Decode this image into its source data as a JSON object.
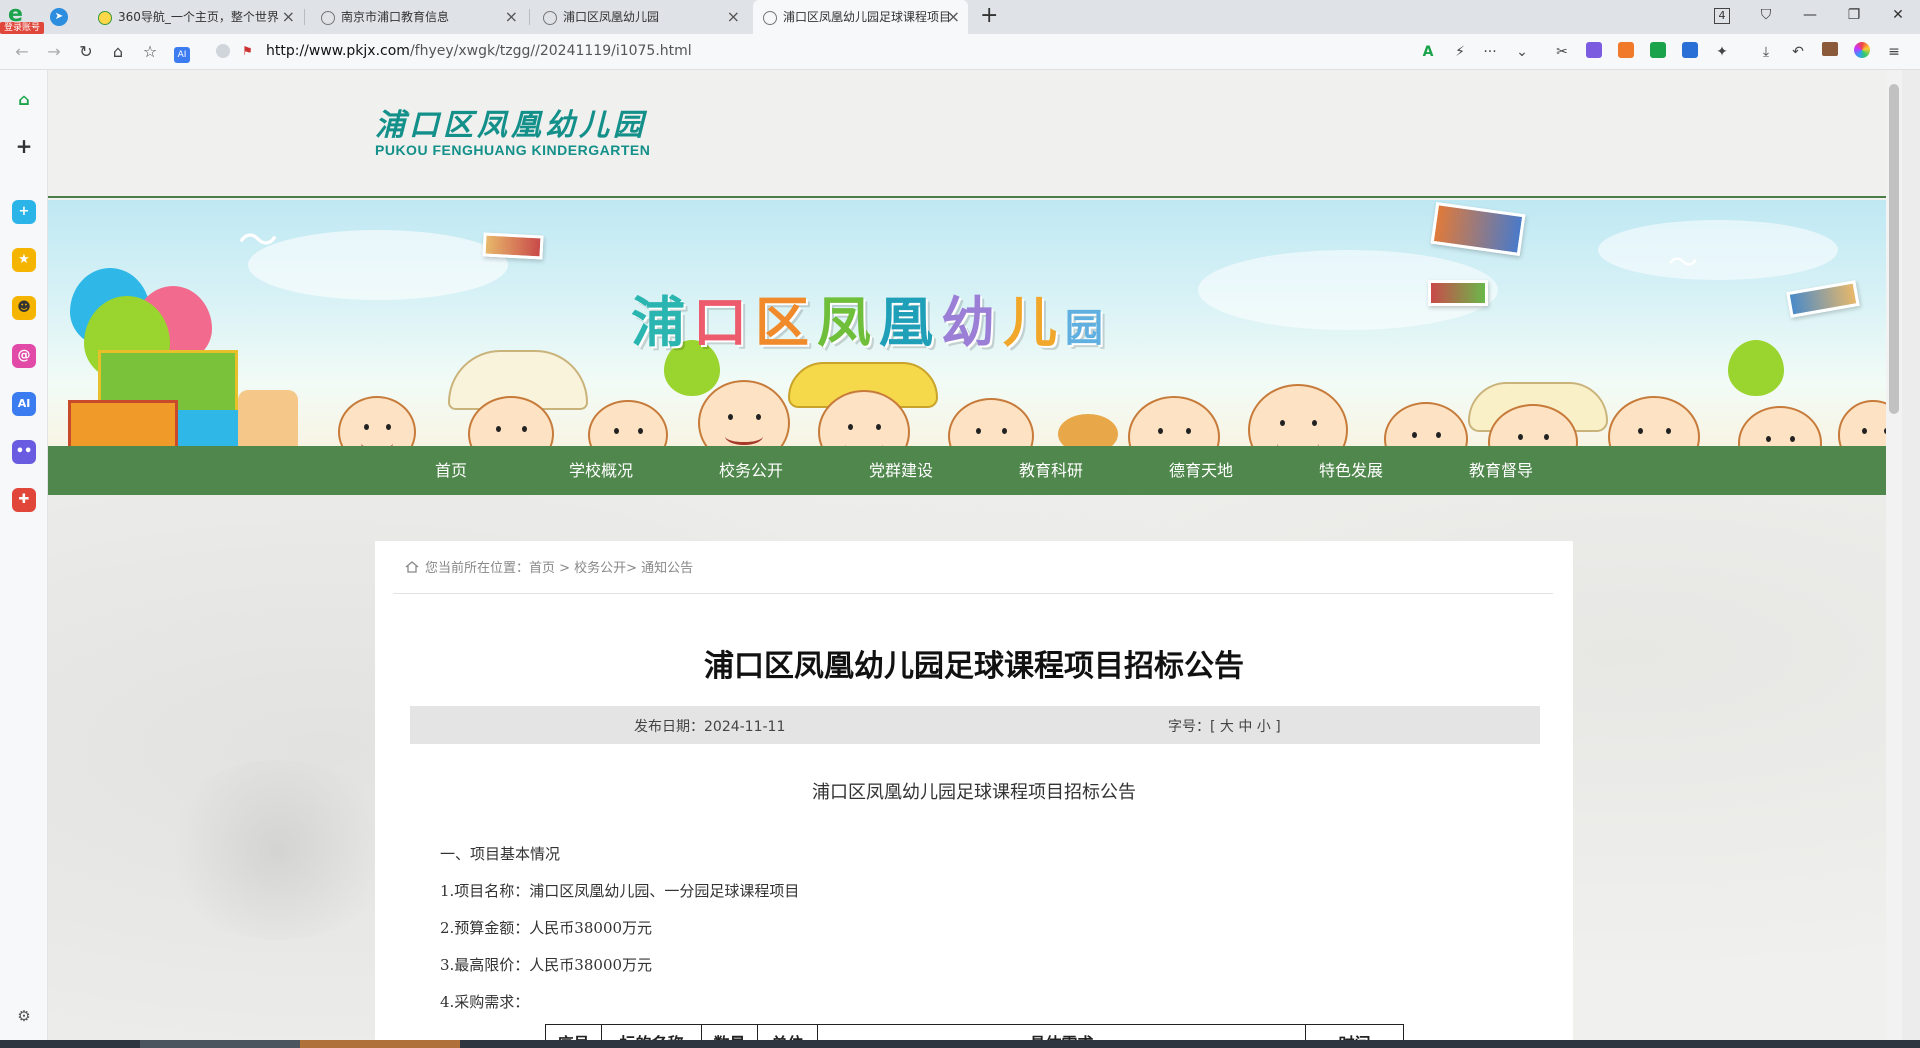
{
  "browser": {
    "login_badge": "登录账号",
    "tabs": [
      {
        "title": "360导航_一个主页，整个世界"
      },
      {
        "title": "南京市浦口教育信息"
      },
      {
        "title": "浦口区凤凰幼儿园"
      },
      {
        "title": "浦口区凤凰幼儿园足球课程项目"
      }
    ],
    "tab_count": "4",
    "url_host": "http://www.pkjx.com",
    "url_path": "/fhyey/xwgk/tzgg//20241119/i1075.html"
  },
  "site": {
    "logo_cn": "浦口区凤凰幼儿园",
    "logo_en": "PUKOU FENGHUANG KINDERGARTEN",
    "banner_chars": [
      {
        "ch": "浦",
        "color": "#2bb5b0"
      },
      {
        "ch": "口",
        "color": "#ec5c6c"
      },
      {
        "ch": "区",
        "color": "#f08a2a"
      },
      {
        "ch": "凤",
        "color": "#6fbf3a"
      },
      {
        "ch": "凰",
        "color": "#1fa0b8"
      },
      {
        "ch": "幼",
        "color": "#9b7fd6"
      },
      {
        "ch": "儿",
        "color": "#f0a72a"
      },
      {
        "ch": "园",
        "color": "#5fb0e0"
      }
    ],
    "menu": [
      "首页",
      "学校概况",
      "校务公开",
      "党群建设",
      "教育科研",
      "德育天地",
      "特色发展",
      "教育督导"
    ]
  },
  "article": {
    "breadcrumb": "您当前所在位置：首页 > 校务公开> 通知公告",
    "title": "浦口区凤凰幼儿园足球课程项目招标公告",
    "date_label": "发布日期：2024-11-11",
    "font_size_label": "字号：[ 大 中 小 ]",
    "subtitle": "浦口区凤凰幼儿园足球课程项目招标公告",
    "paragraphs": [
      "一、项目基本情况",
      "1.项目名称：浦口区凤凰幼儿园、一分园足球课程项目",
      "2.预算金额：人民币38000万元",
      "3.最高限价：人民币38000万元",
      "4.采购需求："
    ],
    "table_headers": [
      "序号",
      "标的名称",
      "数量",
      "单位",
      "具体需求",
      "时间"
    ]
  }
}
